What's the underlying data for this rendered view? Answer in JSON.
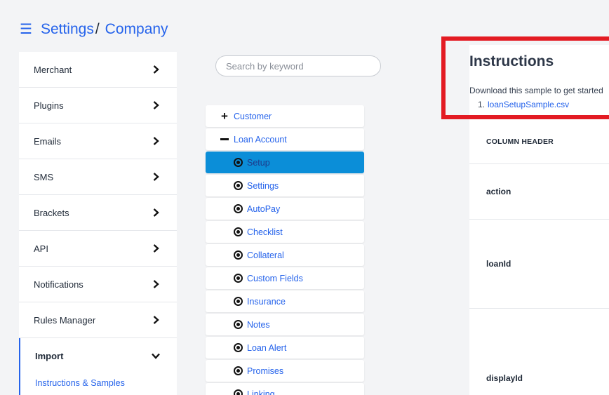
{
  "header": {
    "menu_icon": "hamburger-icon",
    "crumb_1": "Settings",
    "separator": "/",
    "crumb_2": "Company"
  },
  "sidebar": {
    "items": [
      {
        "label": "Merchant"
      },
      {
        "label": "Plugins"
      },
      {
        "label": "Emails"
      },
      {
        "label": "SMS"
      },
      {
        "label": "Brackets"
      },
      {
        "label": "API"
      },
      {
        "label": "Notifications"
      },
      {
        "label": "Rules Manager"
      },
      {
        "label": "Import"
      }
    ],
    "active_sub_item": "Instructions & Samples"
  },
  "search": {
    "placeholder": "Search by keyword",
    "value": ""
  },
  "tree": {
    "items": [
      {
        "label": "Customer",
        "icon": "plus-icon",
        "level": 0
      },
      {
        "label": "Loan Account",
        "icon": "minus-icon",
        "level": 0
      },
      {
        "label": "Setup",
        "icon": "radio-icon",
        "level": 1,
        "selected": true
      },
      {
        "label": "Settings",
        "icon": "radio-icon",
        "level": 1
      },
      {
        "label": "AutoPay",
        "icon": "radio-icon",
        "level": 1
      },
      {
        "label": "Checklist",
        "icon": "radio-icon",
        "level": 1
      },
      {
        "label": "Collateral",
        "icon": "radio-icon",
        "level": 1
      },
      {
        "label": "Custom Fields",
        "icon": "radio-icon",
        "level": 1
      },
      {
        "label": "Insurance",
        "icon": "radio-icon",
        "level": 1
      },
      {
        "label": "Notes",
        "icon": "radio-icon",
        "level": 1
      },
      {
        "label": "Loan Alert",
        "icon": "radio-icon",
        "level": 1
      },
      {
        "label": "Promises",
        "icon": "radio-icon",
        "level": 1
      },
      {
        "label": "Linking",
        "icon": "radio-icon",
        "level": 1
      }
    ]
  },
  "instructions": {
    "title": "Instructions",
    "text": "Download this sample to get started",
    "link_number": "1.",
    "link_label": "loanSetupSample.csv"
  },
  "table": {
    "column_header": "COLUMN HEADER",
    "rows": [
      "action",
      "loanId",
      "displayId"
    ]
  },
  "colors": {
    "accent": "#2563eb",
    "selected_row": "#0b8ed8",
    "highlight_box": "#e31b23",
    "background": "#f3f4f6"
  }
}
